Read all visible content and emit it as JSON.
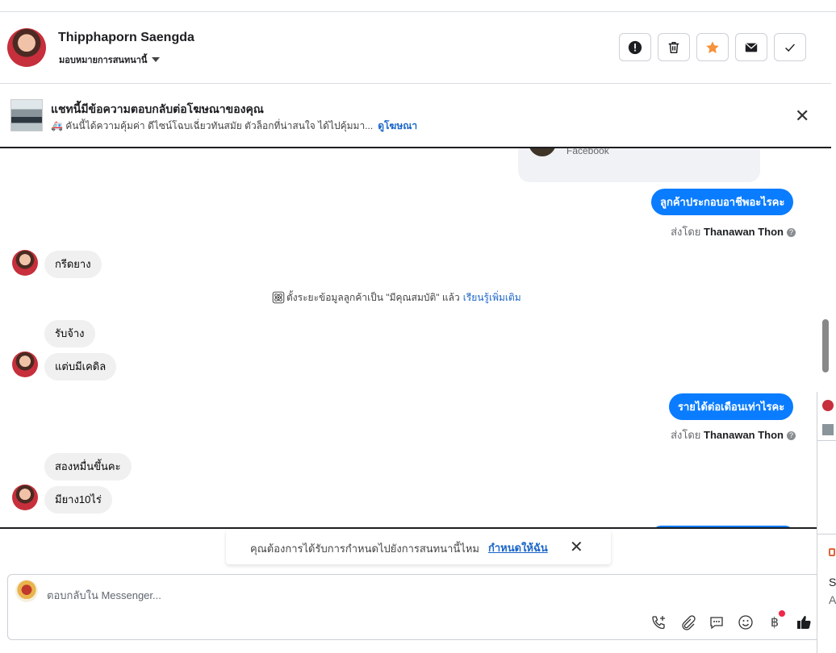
{
  "header": {
    "name": "Thipphaporn Saengda",
    "assign_label": "มอบหมายการสนทนานี้"
  },
  "banner": {
    "title": "แชทนี้มีข้อความตอบกลับต่อโฆษณาของคุณ",
    "subtitle": "🚑 คันนี้ได้ความคุ้มค่า ดีไซน์โฉบเฉี่ยวทันสมัย ตัวล็อกที่น่าสนใจ ได้ไปคุ้มมา...",
    "link": "ดูโฆษณา"
  },
  "chat": {
    "card_source": "Facebook",
    "sent_by_prefix": "ส่งโดย",
    "messages_out": [
      "ลูกค้าประกอบอาชีพอะไรคะ",
      "รายได้ต่อเดือนเท่าไรคะ"
    ],
    "sent_by_name": "Thanawan Thon",
    "messages_in": [
      "กรีดยาง",
      "รับจ้าง",
      "แต่บมีเคดิล",
      "สองหมื่นขึ้นคะ",
      "มียาง10ไร่"
    ],
    "system_message": "ตั้งระยะข้อมูลลูกค้าเป็น \"มีคุณสมบัติ\" แล้ว",
    "system_link": "เรียนรู้เพิ่มเติม"
  },
  "prompt": {
    "text": "คุณต้องการได้รับการกำหนดไปยังการสนทนานี้ไหม",
    "link": "กำหนดให้ฉัน"
  },
  "composer": {
    "placeholder": "ตอบกลับใน Messenger..."
  },
  "sidepanel": {
    "t1": "S",
    "t2": "A"
  },
  "colors": {
    "accent": "#0a7cff",
    "link": "#1b66c9",
    "star": "#f7923a",
    "incoming_bubble": "#f0f0f0"
  }
}
